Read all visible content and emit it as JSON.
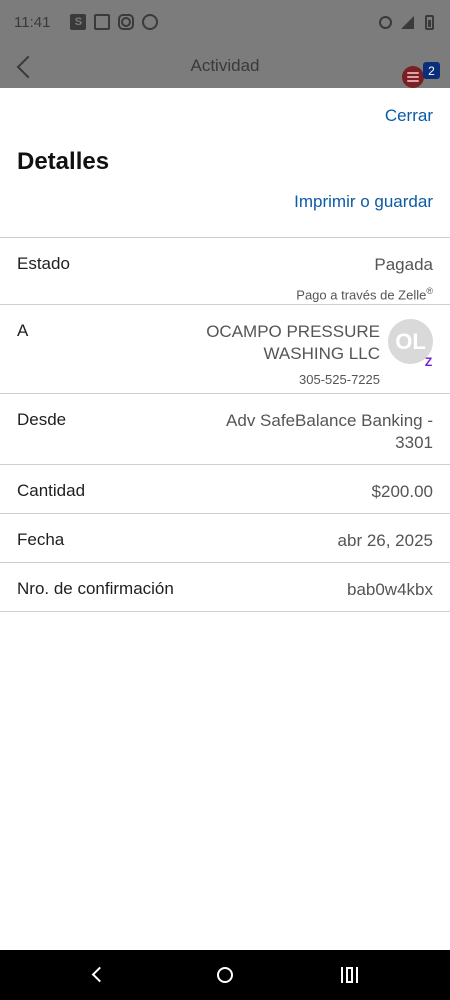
{
  "status_bar": {
    "time": "11:41",
    "left_icons": [
      "s-app-icon",
      "news-icon",
      "instagram-icon",
      "chat-bubble-icon"
    ],
    "right_icons": [
      "alarm-icon",
      "signal-icon",
      "battery-icon"
    ]
  },
  "app_header": {
    "title": "Actividad",
    "badge_count": "2"
  },
  "sheet": {
    "close_label": "Cerrar",
    "title": "Detalles",
    "print_label": "Imprimir o guardar"
  },
  "details": {
    "estado": {
      "label": "Estado",
      "value": "Pagada",
      "sub": "Pago a través de Zelle",
      "sub_mark": "®"
    },
    "a": {
      "label": "A",
      "name_line1": "OCAMPO PRESSURE",
      "name_line2": "WASHING LLC",
      "phone": "305-525-7225",
      "avatar_initials": "OL"
    },
    "desde": {
      "label": "Desde",
      "line1": "Adv SafeBalance Banking -",
      "line2": "3301"
    },
    "cantidad": {
      "label": "Cantidad",
      "value": "$200.00"
    },
    "fecha": {
      "label": "Fecha",
      "value": "abr 26, 2025"
    },
    "confirmacion": {
      "label": "Nro. de confirmación",
      "value": "bab0w4kbx"
    }
  },
  "colors": {
    "link": "#0b5ba7",
    "zelle": "#6d1ed4",
    "badge": "#0a2f7a"
  }
}
